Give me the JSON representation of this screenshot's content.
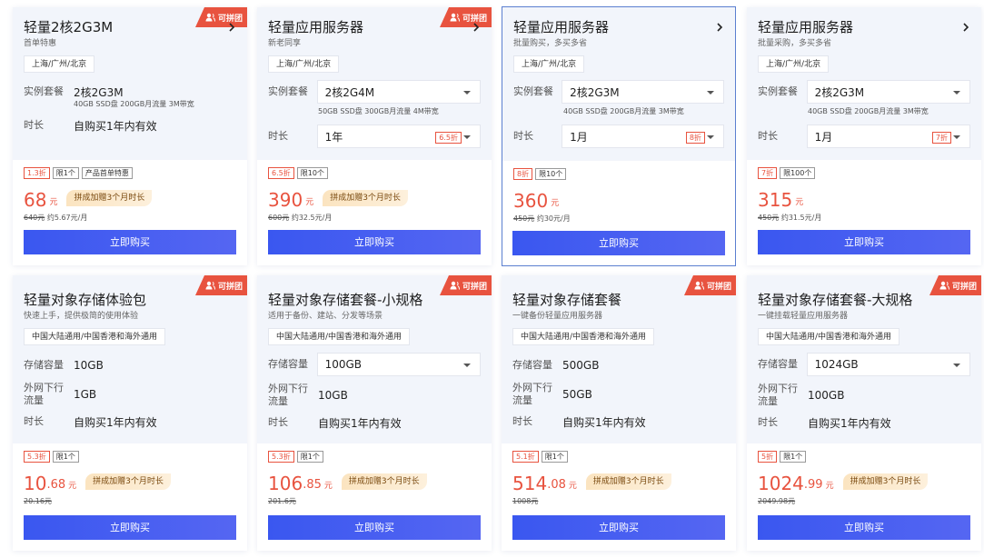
{
  "badge_label": "可拼团",
  "buy_label": "立即购买",
  "select_label": "实例套餐",
  "duration_label": "时长",
  "row1": [
    {
      "title": "轻量2核2G3M",
      "subtitle": "首单特惠",
      "region": "上海/广州/北京",
      "plan": "2核2G3M",
      "plan_detail": "40GB SSD盘 200GB月流量 3M带宽",
      "duration": "自购买1年内有效",
      "tags": [
        "1.3折",
        "限1个",
        "产品首单特惠"
      ],
      "price": "68",
      "yuan": "元",
      "promo": "拼成加赠3个月时长",
      "orig_price": "640元",
      "per_month": "约5.67元/月",
      "has_badge": true
    },
    {
      "title": "轻量应用服务器",
      "subtitle": "新老同享",
      "region": "上海/广州/北京",
      "plan": "2核2G4M",
      "plan_detail": "50GB SSD盘 300GB月流量 4M带宽",
      "duration": "1年",
      "duration_disc": "6.5折",
      "tags": [
        "6.5折",
        "限10个"
      ],
      "price": "390",
      "yuan": "元",
      "promo": "拼成加赠3个月时长",
      "orig_price": "600元",
      "per_month": "约32.5元/月",
      "has_badge": true
    },
    {
      "title": "轻量应用服务器",
      "subtitle": "批量购买，多买多省",
      "region": "上海/广州/北京",
      "plan": "2核2G3M",
      "plan_detail": "40GB SSD盘 200GB月流量 3M带宽",
      "duration": "1月",
      "duration_disc": "8折",
      "tags": [
        "8折",
        "限10个"
      ],
      "price": "360",
      "yuan": "元",
      "orig_price": "450元",
      "per_month": "约30元/月",
      "has_badge": false
    },
    {
      "title": "轻量应用服务器",
      "subtitle": "批量采购，多买多省",
      "region": "上海/广州/北京",
      "plan": "2核2G3M",
      "plan_detail": "40GB SSD盘 200GB月流量 3M带宽",
      "duration": "1月",
      "duration_disc": "7折",
      "tags": [
        "7折",
        "限100个"
      ],
      "price": "315",
      "yuan": "元",
      "orig_price": "450元",
      "per_month": "约31.5元/月",
      "has_badge": false
    }
  ],
  "row2": [
    {
      "title": "轻量对象存储体验包",
      "subtitle": "快速上手，提供极简的使用体验",
      "region": "中国大陆通用/中国香港和海外通用",
      "capacity_label": "存储容量",
      "capacity": "10GB",
      "traffic_label": "外网下行流量",
      "traffic": "1GB",
      "duration": "自购买1年内有效",
      "tags": [
        "5.3折",
        "限1个"
      ],
      "price": "10",
      "price_dec": ".68",
      "yuan": "元",
      "promo": "拼成加赠3个月时长",
      "orig_price": "20.16元",
      "has_badge": true
    },
    {
      "title": "轻量对象存储套餐-小规格",
      "subtitle": "适用于备份、建站、分发等场景",
      "region": "中国大陆通用/中国香港和海外通用",
      "capacity_label": "存储容量",
      "capacity": "100GB",
      "traffic_label": "外网下行流量",
      "traffic": "10GB",
      "duration": "自购买1年内有效",
      "tags": [
        "5.3折",
        "限1个"
      ],
      "price": "106",
      "price_dec": ".85",
      "yuan": "元",
      "promo": "拼成加赠3个月时长",
      "orig_price": "201.6元",
      "has_badge": true
    },
    {
      "title": "轻量对象存储套餐",
      "subtitle": "一键备份轻量应用服务器",
      "region": "中国大陆通用/中国香港和海外通用",
      "capacity_label": "存储容量",
      "capacity": "500GB",
      "traffic_label": "外网下行流量",
      "traffic": "50GB",
      "duration": "自购买1年内有效",
      "tags": [
        "5.1折",
        "限1个"
      ],
      "price": "514",
      "price_dec": ".08",
      "yuan": "元",
      "promo": "拼成加赠3个月时长",
      "orig_price": "1008元",
      "has_badge": true
    },
    {
      "title": "轻量对象存储套餐-大规格",
      "subtitle": "一键挂载轻量应用服务器",
      "region": "中国大陆通用/中国香港和海外通用",
      "capacity_label": "存储容量",
      "capacity": "1024GB",
      "traffic_label": "外网下行流量",
      "traffic": "100GB",
      "duration": "自购买1年内有效",
      "tags": [
        "5折",
        "限1个"
      ],
      "price": "1024",
      "price_dec": ".99",
      "yuan": "元",
      "promo": "拼成加赠3个月时长",
      "orig_price": "2049.98元",
      "has_badge": true
    }
  ],
  "colors": {
    "accent": "#e8533f",
    "button": "#3a57f0",
    "card_top": "#f2f5fb",
    "highlight_border": "#5b7fd0"
  },
  "icons": {
    "badge": "group-users-icon",
    "arrow": "chevron-right-icon",
    "select": "caret-down-icon"
  }
}
